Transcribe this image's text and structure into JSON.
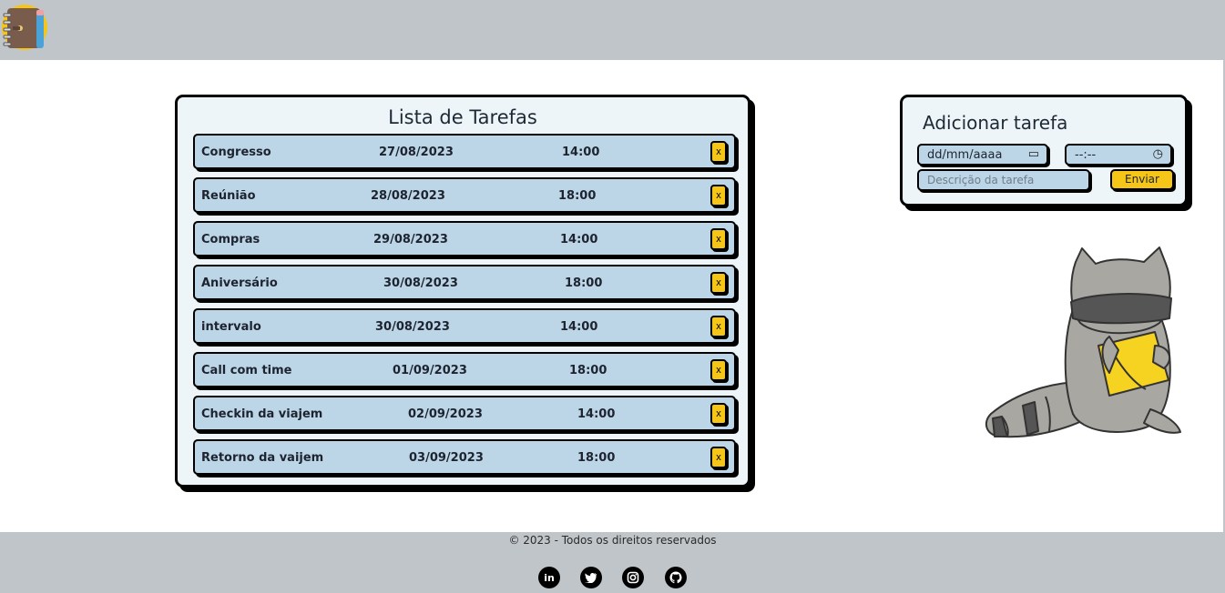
{
  "header": {
    "logo_icon": "notebook-icon"
  },
  "tasks": {
    "title": "Lista de Tarefas",
    "delete_label": "x",
    "items": [
      {
        "name": "Congresso",
        "date": "27/08/2023",
        "time": "14:00"
      },
      {
        "name": "Reúnião",
        "date": "28/08/2023",
        "time": "18:00"
      },
      {
        "name": "Compras",
        "date": "29/08/2023",
        "time": "14:00"
      },
      {
        "name": "Aniversário",
        "date": "30/08/2023",
        "time": "18:00"
      },
      {
        "name": "intervalo",
        "date": "30/08/2023",
        "time": "14:00"
      },
      {
        "name": "Call com time",
        "date": "01/09/2023",
        "time": "18:00"
      },
      {
        "name": "Checkin da viajem",
        "date": "02/09/2023",
        "time": "14:00"
      },
      {
        "name": "Retorno da vaijem",
        "date": "03/09/2023",
        "time": "18:00"
      }
    ]
  },
  "add_form": {
    "title": "Adicionar tarefa",
    "date_placeholder": "dd/mm/aaaa",
    "time_placeholder": "--:--",
    "description_placeholder": "Descrição da tarefa",
    "submit_label": "Enviar"
  },
  "footer": {
    "copyright": "© 2023 - Todos os direitos reservados",
    "social": [
      "linkedin-icon",
      "twitter-icon",
      "instagram-icon",
      "github-icon"
    ]
  },
  "colors": {
    "accent": "#f5c518",
    "row_bg": "#bcd6e7",
    "card_bg": "#eef5f9",
    "bar_bg": "#c0c5c9"
  }
}
